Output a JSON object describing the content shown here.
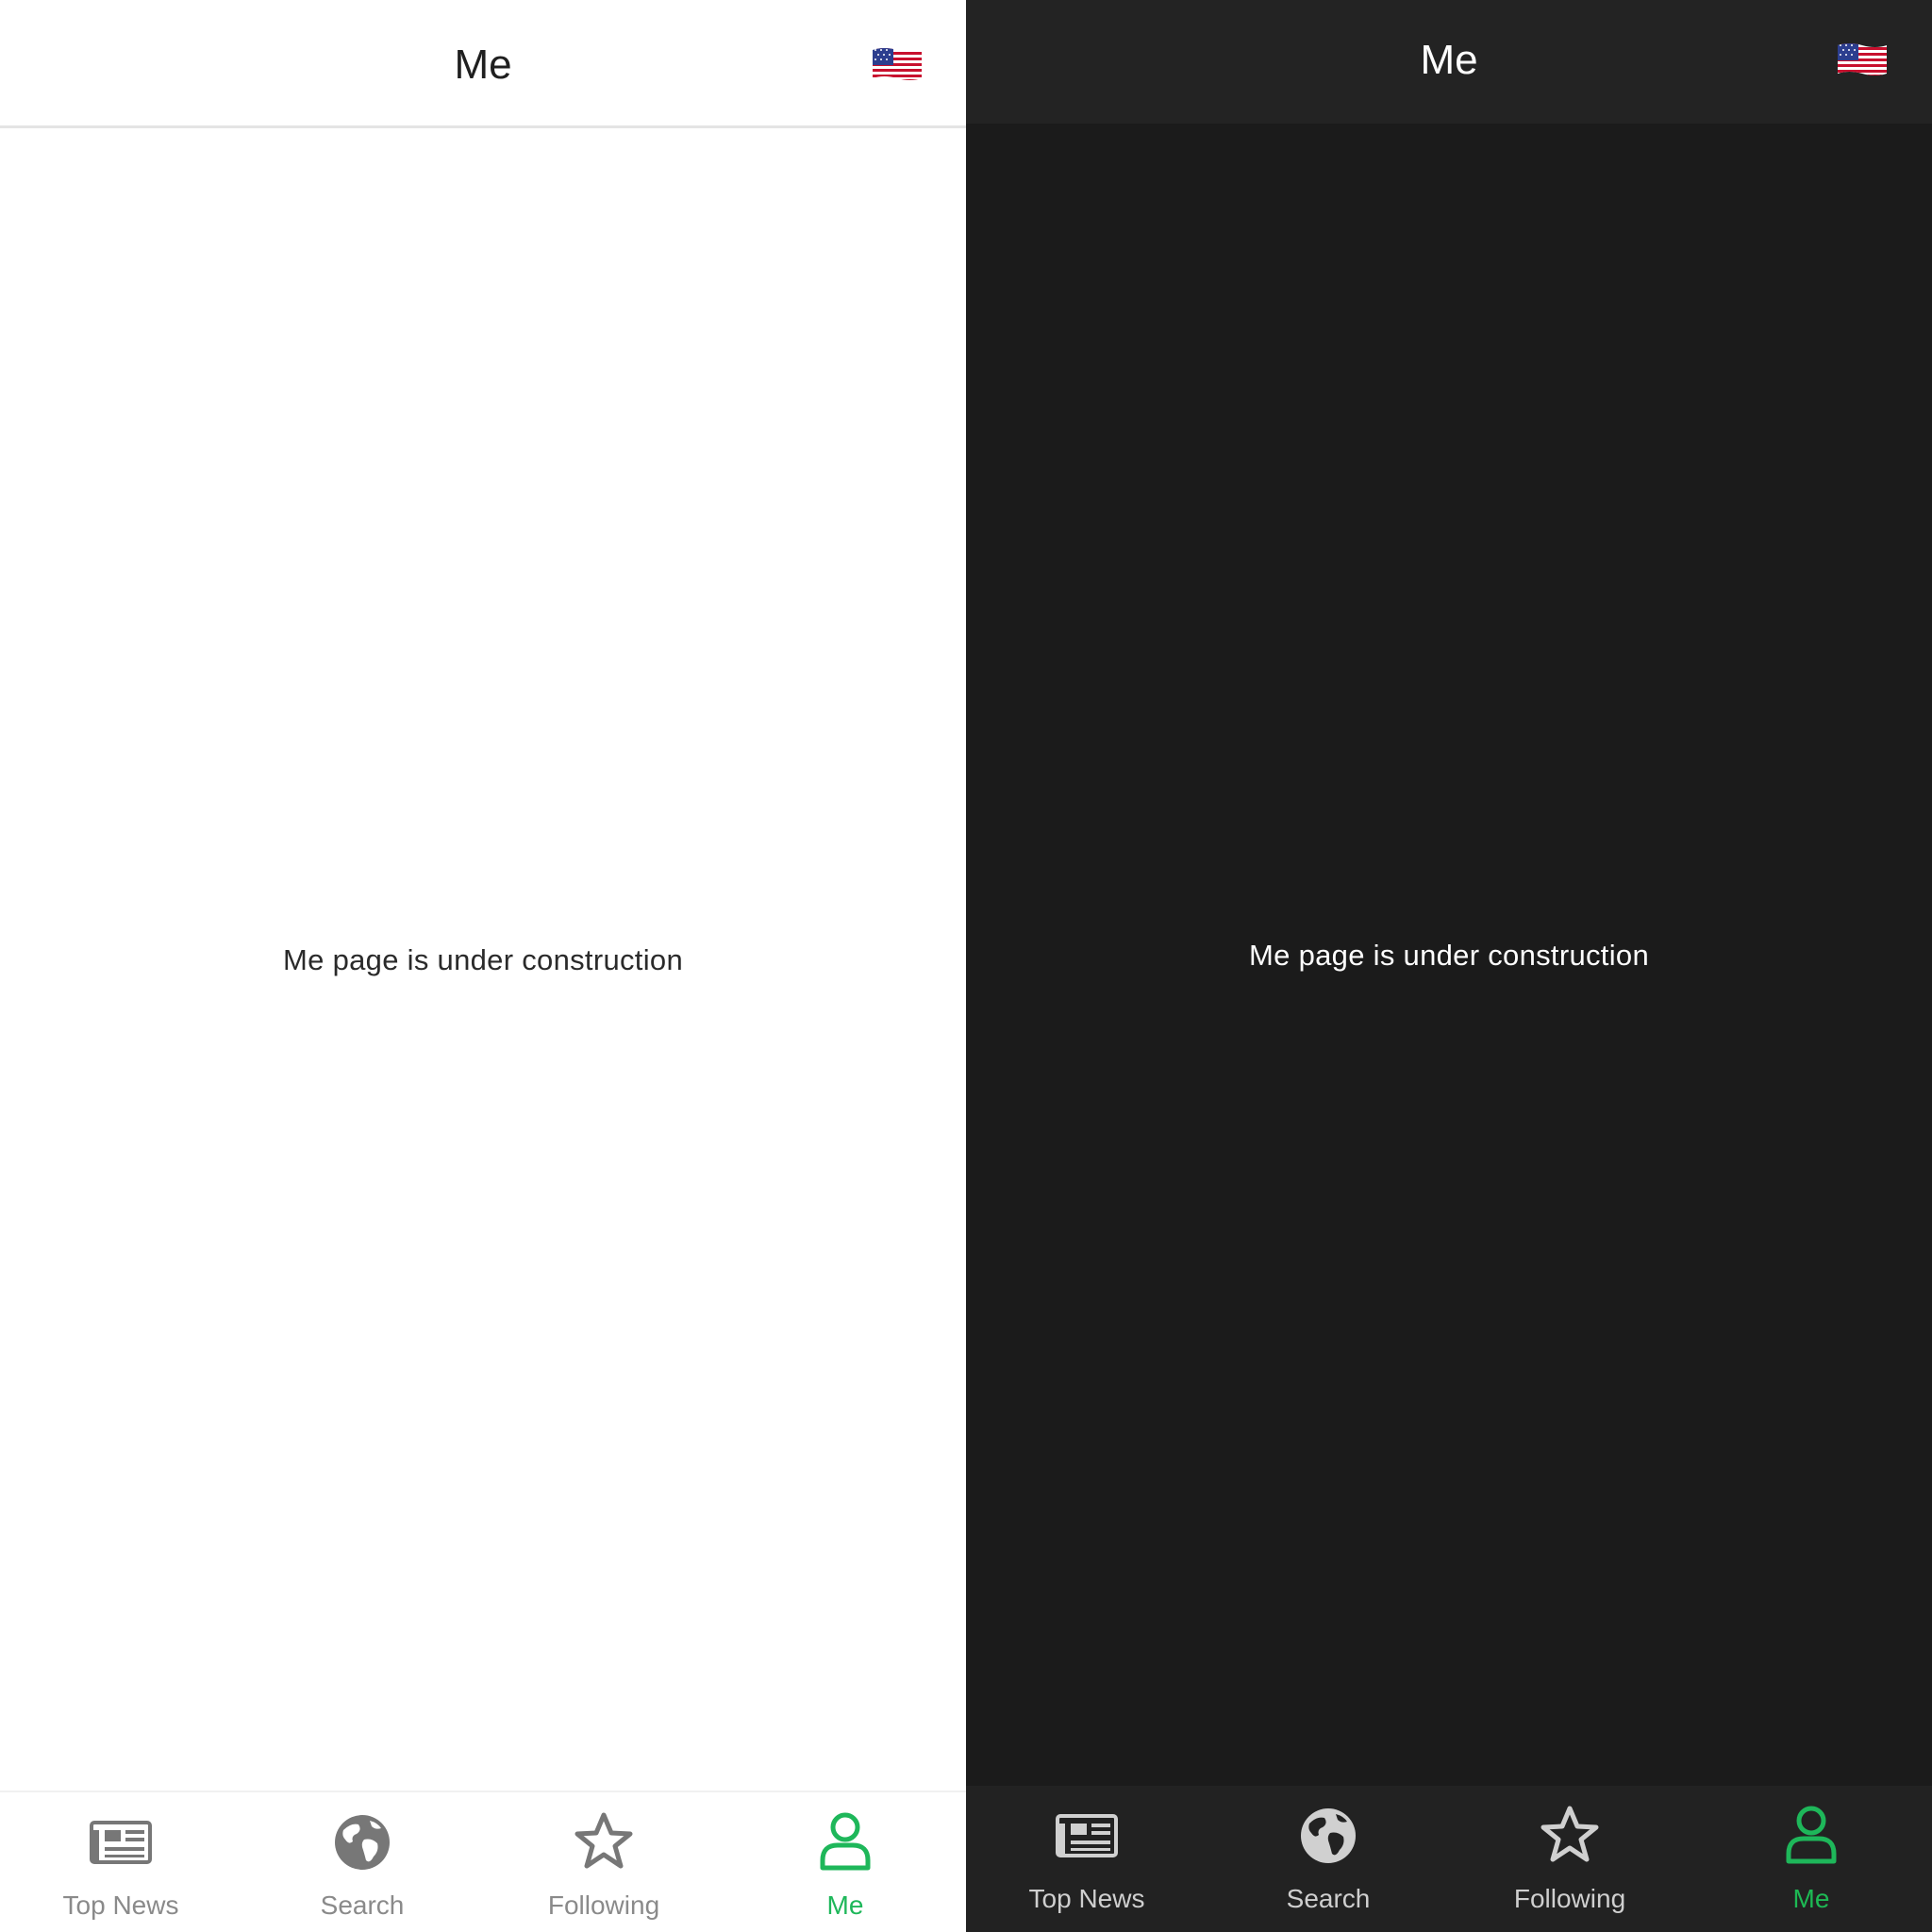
{
  "colors": {
    "accent": "#1EB75A",
    "light_icon": "#777777",
    "dark_icon": "#D0D0D0",
    "dark_bg": "#1B1B1B",
    "dark_bar": "#232323"
  },
  "light": {
    "header": {
      "title": "Me",
      "flag_icon": "us-flag-icon"
    },
    "main": {
      "message": "Me page is under construction"
    },
    "tabbar": {
      "tabs": [
        {
          "label": "Top News",
          "icon": "newspaper-icon",
          "active": false
        },
        {
          "label": "Search",
          "icon": "globe-icon",
          "active": false
        },
        {
          "label": "Following",
          "icon": "star-icon",
          "active": false
        },
        {
          "label": "Me",
          "icon": "person-icon",
          "active": true
        }
      ]
    }
  },
  "dark": {
    "header": {
      "title": "Me",
      "flag_icon": "us-flag-icon"
    },
    "main": {
      "message": "Me page is under construction"
    },
    "tabbar": {
      "tabs": [
        {
          "label": "Top News",
          "icon": "newspaper-icon",
          "active": false
        },
        {
          "label": "Search",
          "icon": "globe-icon",
          "active": false
        },
        {
          "label": "Following",
          "icon": "star-icon",
          "active": false
        },
        {
          "label": "Me",
          "icon": "person-icon",
          "active": true
        }
      ]
    }
  }
}
